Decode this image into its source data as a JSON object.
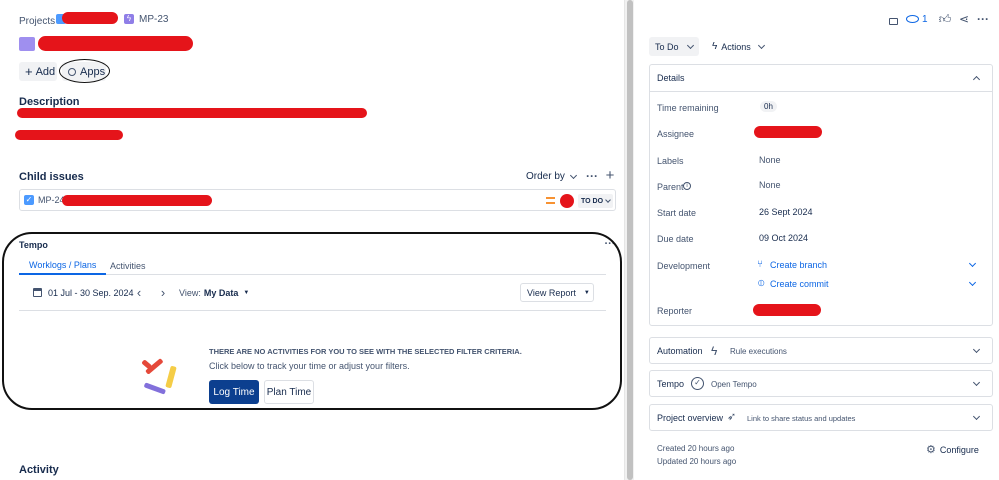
{
  "breadcrumb": {
    "projects": "Projects",
    "sep": "/",
    "issue_key": "MP-23"
  },
  "toolbar": {
    "add_label": "Add",
    "apps_label": "Apps"
  },
  "description": {
    "heading": "Description"
  },
  "child_issues": {
    "heading": "Child issues",
    "order_by": "Order by",
    "items": [
      {
        "key": "MP-24",
        "status": "TO DO"
      }
    ]
  },
  "tempo": {
    "title": "Tempo",
    "tabs": [
      "Worklogs / Plans",
      "Activities"
    ],
    "date_range": "01 Jul - 30 Sep. 2024",
    "view_label": "View:",
    "view_value": "My Data",
    "view_report": "View Report",
    "empty_title": "THERE ARE NO ACTIVITIES FOR YOU TO SEE WITH THE SELECTED FILTER CRITERIA.",
    "empty_sub": "Click below to track your time or adjust your filters.",
    "log_time": "Log Time",
    "plan_time": "Plan Time",
    "colors": {
      "red": "#e5493a",
      "yellow": "#f5cd47",
      "purple": "#8270db"
    }
  },
  "activity": {
    "heading": "Activity"
  },
  "right": {
    "watch_count": "1",
    "status_button": "To Do",
    "actions_button": "Actions",
    "details": {
      "heading": "Details",
      "time_remaining_label": "Time remaining",
      "time_remaining_value": "0h",
      "assignee_label": "Assignee",
      "labels_label": "Labels",
      "labels_value": "None",
      "parent_label": "Parent",
      "parent_value": "None",
      "start_label": "Start date",
      "start_value": "26 Sept 2024",
      "due_label": "Due date",
      "due_value": "09 Oct 2024",
      "development_label": "Development",
      "create_branch": "Create branch",
      "create_commit": "Create commit",
      "reporter_label": "Reporter"
    },
    "automation": {
      "title": "Automation",
      "sub": "Rule executions"
    },
    "tempo": {
      "title": "Tempo",
      "sub": "Open Tempo"
    },
    "project_overview": {
      "title": "Project overview",
      "sub": "Link to share status and updates"
    },
    "created": "Created 20 hours ago",
    "updated": "Updated 20 hours ago",
    "configure": "Configure"
  },
  "colors": {
    "accent": "#0c66e4",
    "primary_button": "#0c3f8f",
    "redaction": "#e5141a",
    "priority": "#f79232"
  }
}
